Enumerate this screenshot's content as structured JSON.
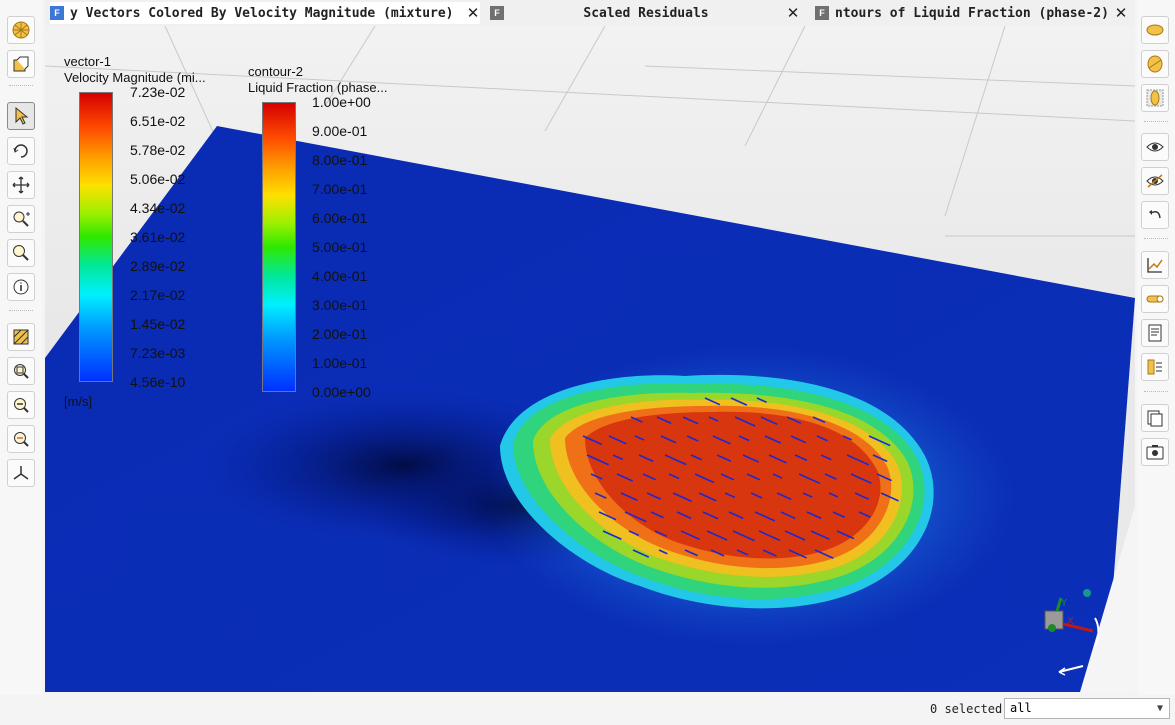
{
  "tabs": [
    {
      "label": "y Vectors Colored By Velocity Magnitude (mixture)",
      "icon": "fluent-f-icon",
      "close": "✕"
    },
    {
      "label": "Scaled Residuals",
      "icon": "fluent-f-icon",
      "close": "✕"
    },
    {
      "label": "ntours of Liquid Fraction (phase-2)",
      "icon": "fluent-f-icon",
      "close": "✕"
    }
  ],
  "legend_velocity": {
    "title_line1": "vector-1",
    "title_line2": "Velocity Magnitude (mi...",
    "ticks": [
      "7.23e-02",
      "6.51e-02",
      "5.78e-02",
      "5.06e-02",
      "4.34e-02",
      "3.61e-02",
      "2.89e-02",
      "2.17e-02",
      "1.45e-02",
      "7.23e-03",
      "4.56e-10"
    ],
    "units": "[m/s]"
  },
  "legend_liquid": {
    "title_line1": "contour-2",
    "title_line2": "Liquid Fraction (phase...",
    "ticks": [
      "1.00e+00",
      "9.00e-01",
      "8.00e-01",
      "7.00e-01",
      "6.00e-01",
      "5.00e-01",
      "4.00e-01",
      "3.00e-01",
      "2.00e-01",
      "1.00e-01",
      "0.00e+00"
    ]
  },
  "left_toolbar": [
    "isometric-view-icon",
    "fit-to-window-icon",
    "select-pointer-icon",
    "rotate-icon",
    "pan-icon",
    "zoom-in-out-icon",
    "zoom-to-area-icon",
    "probe-info-icon",
    "render-mesh-icon",
    "zoom-to-fit-icon",
    "zoom-out-icon",
    "zoom-previous-icon",
    "axes-triad-icon"
  ],
  "right_toolbar": [
    "view-plane-x-icon",
    "view-plane-y-icon",
    "view-plane-z-icon",
    "view-eye-icon",
    "view-eye-hidden-icon",
    "undo-view-icon",
    "xy-plot-icon",
    "colormap-icon",
    "report-icon",
    "compare-icon",
    "copy-icon",
    "screenshot-icon"
  ],
  "status": {
    "selected_text": "0 selected",
    "filter_value": "all"
  },
  "colors": {
    "domain_blue": "#0a2db0",
    "melt_red": "#d63c10",
    "background": "#e6e6e6"
  }
}
